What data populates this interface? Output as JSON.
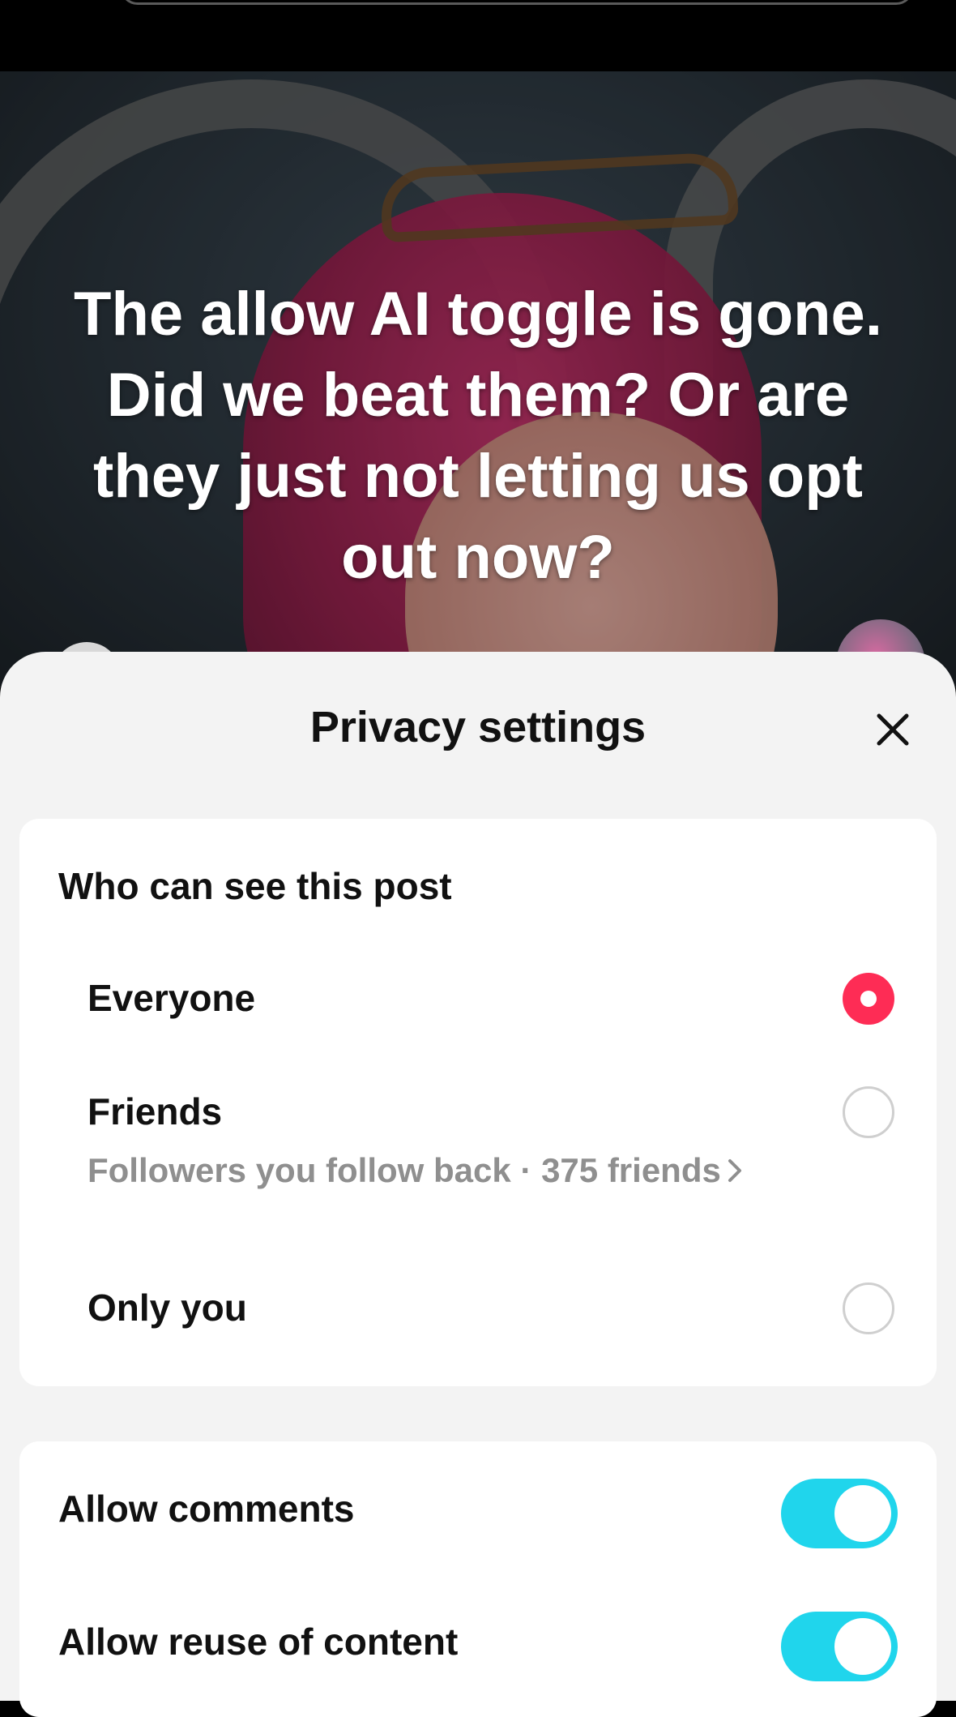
{
  "video": {
    "caption": "The allow AI toggle is gone. Did we beat them? Or are they just not letting us opt out now?"
  },
  "sheet": {
    "title": "Privacy settings",
    "close_icon": "close-icon",
    "visibility": {
      "heading": "Who can see this post",
      "options": [
        {
          "label": "Everyone",
          "selected": true
        },
        {
          "label": "Friends",
          "sublabel": "Followers you follow back · 375 friends",
          "selected": false
        },
        {
          "label": "Only you",
          "selected": false
        }
      ]
    },
    "toggles": [
      {
        "label": "Allow comments",
        "on": true
      },
      {
        "label": "Allow reuse of content",
        "on": true
      }
    ]
  },
  "colors": {
    "accent_radio": "#fe2c55",
    "toggle_on": "#20d5ec"
  }
}
